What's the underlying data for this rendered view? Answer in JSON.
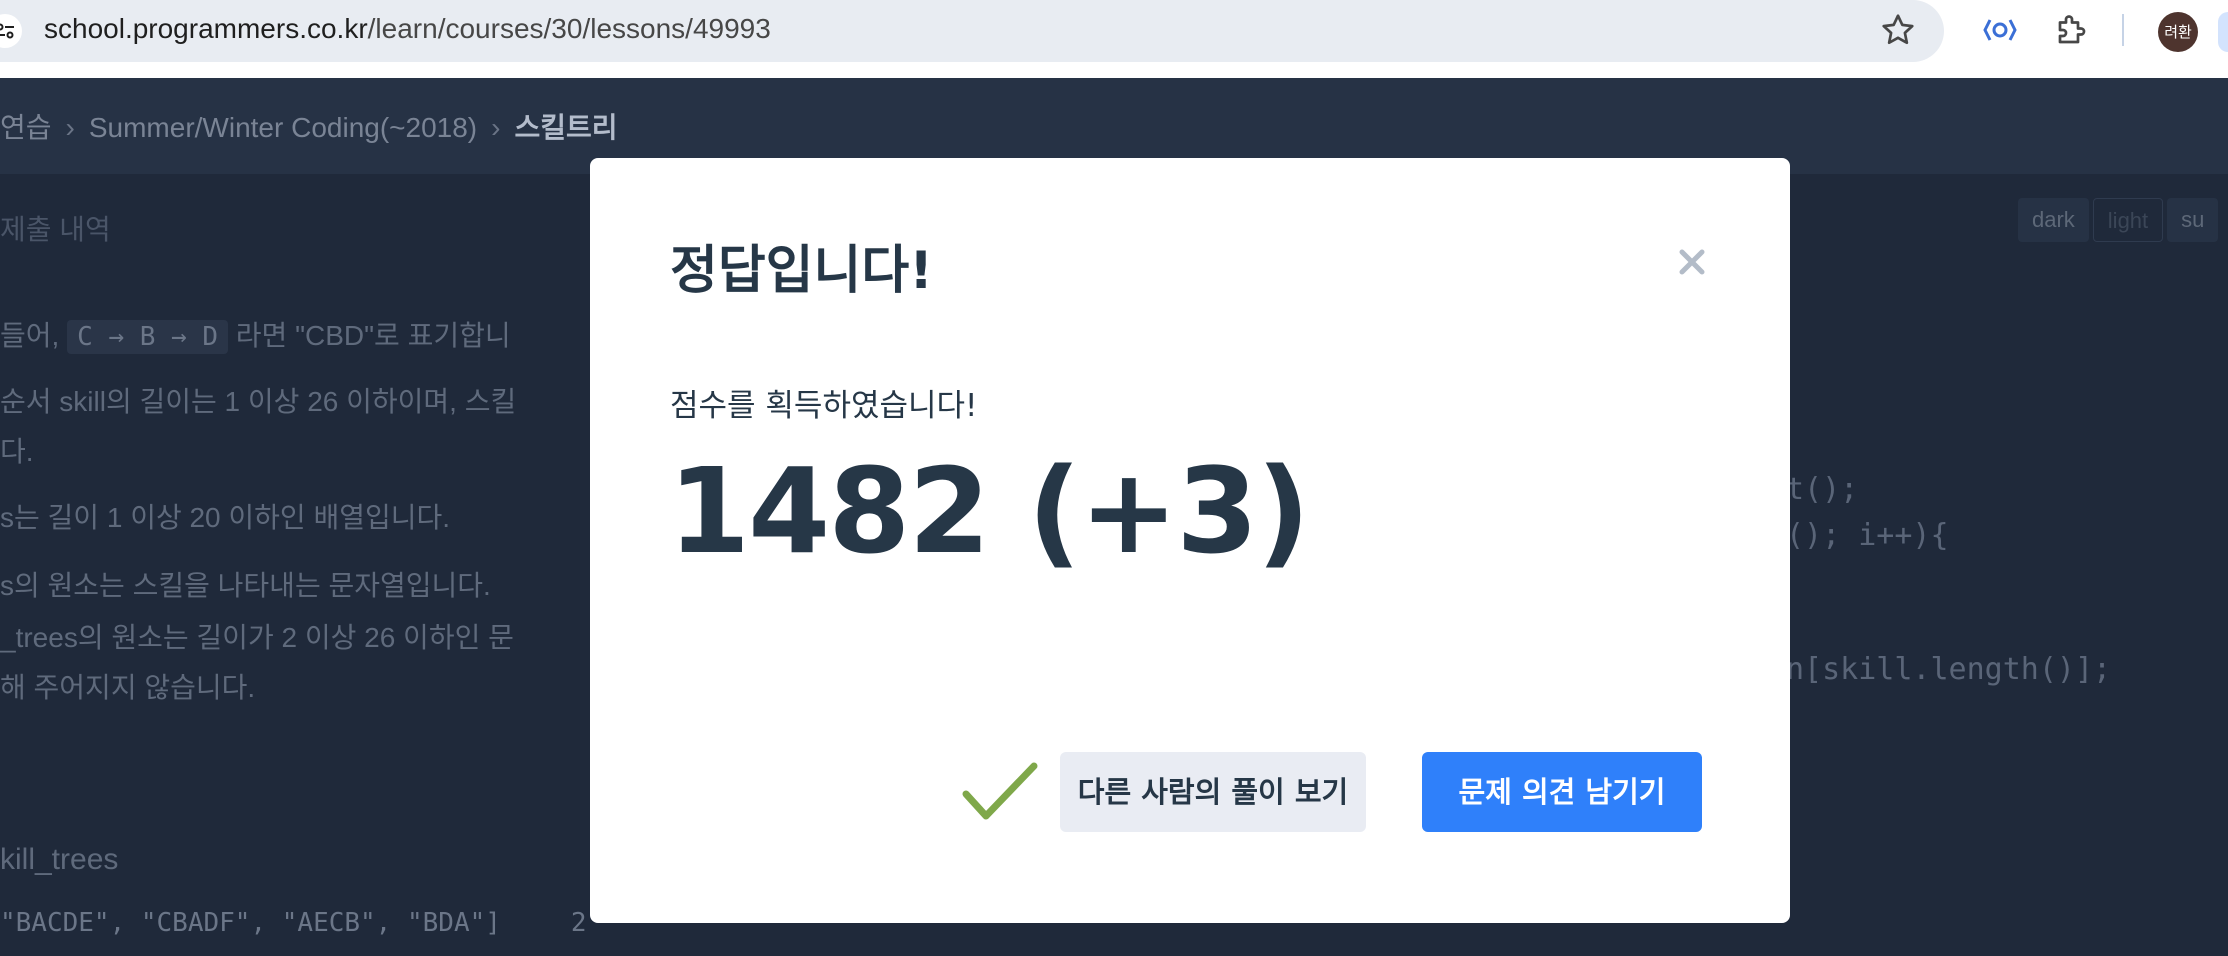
{
  "browser": {
    "url_host": "school.programmers.co.kr",
    "url_path": "/learn/courses/30/lessons/49993",
    "profile_initials": "려환",
    "icons": [
      "site-info-icon",
      "star-icon",
      "devtools-extension-icon",
      "extensions-puzzle-icon"
    ]
  },
  "page": {
    "breadcrumb": [
      "연습",
      "Summer/Winter Coding(~2018)",
      "스킬트리"
    ],
    "submit_history": "제출 내역",
    "theme": {
      "dark": "dark",
      "light": "light",
      "sub": "su"
    },
    "desc_lines": {
      "l1_pre": "들어,",
      "l1_code": "C → B → D",
      "l1_post": "라면 \"CBD\"로 표기합니",
      "l2": "순서 skill의 길이는 1 이상 26 이하이며, 스킬",
      "l3": "다.",
      "l4": "s는 길이 1 이상 20 이하인 배열입니다.",
      "l5": "s의 원소는 스킬을 나타내는 문자열입니다.",
      "l6": "_trees의 원소는 길이가 2 이상 26 이하인 문",
      "l7": "해 주어지지 않습니다."
    },
    "section_label": "kill_trees",
    "table_row_value": "\"BACDE\", \"CBADF\", \"AECB\", \"BDA\"]",
    "table_row_result": "2",
    "code_lines": {
      "c1": "t();",
      "c2": "(); i++){",
      "c3": "n[skill.length()];"
    }
  },
  "modal": {
    "title": "정답입니다!",
    "score_caption": "점수를 획득하였습니다!",
    "score_value": "1482 (+3)",
    "btn_other_solutions": "다른 사람의 풀이 보기",
    "btn_feedback": "문제 의견 남기기",
    "check_color": "#7fa84a",
    "primary_color": "#2f80fa"
  }
}
